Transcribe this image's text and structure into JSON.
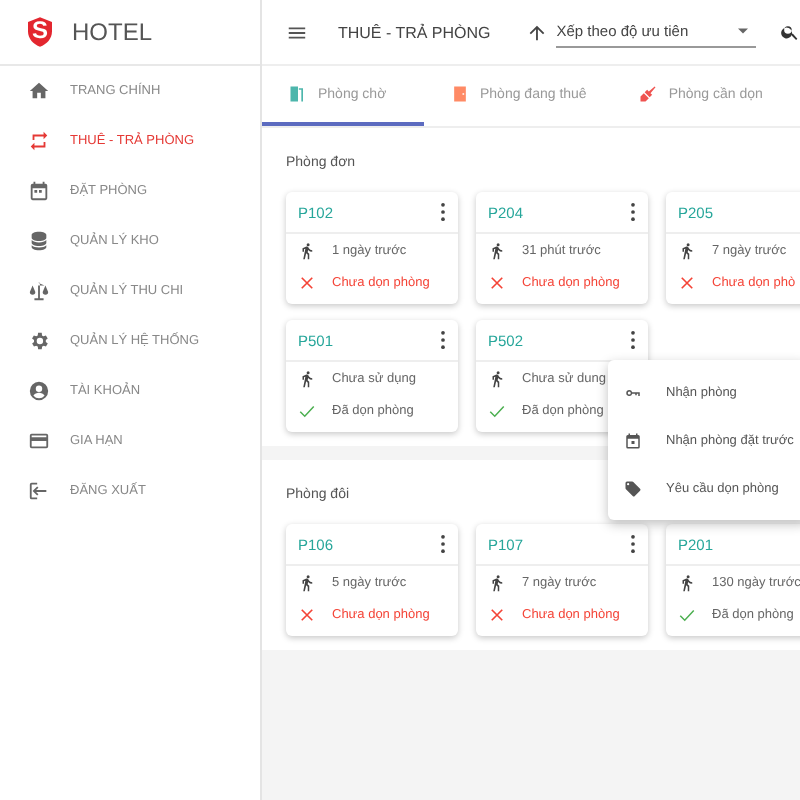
{
  "brand": {
    "name": "HOTEL",
    "logo_letter": "S"
  },
  "sidebar": {
    "items": [
      {
        "label": "TRANG CHÍNH",
        "selected": false
      },
      {
        "label": "THUÊ - TRẢ PHÒNG",
        "selected": true
      },
      {
        "label": "ĐẶT PHÒNG",
        "selected": false
      },
      {
        "label": "QUẢN LÝ KHO",
        "selected": false
      },
      {
        "label": "QUẢN LÝ THU CHI",
        "selected": false
      },
      {
        "label": "QUẢN LÝ HỆ THỐNG",
        "selected": false
      },
      {
        "label": "TÀI KHOẢN",
        "selected": false
      },
      {
        "label": "GIA HẠN",
        "selected": false
      },
      {
        "label": "ĐĂNG XUẤT",
        "selected": false
      }
    ]
  },
  "header": {
    "title": "THUÊ - TRẢ PHÒNG",
    "sort": {
      "value": "Xếp theo độ ưu tiên"
    }
  },
  "tabs": [
    {
      "label": "Phòng chờ",
      "selected": true
    },
    {
      "label": "Phòng đang thuê",
      "selected": false
    },
    {
      "label": "Phòng cần dọn",
      "selected": false
    }
  ],
  "sections": [
    {
      "title": "Phòng đơn",
      "rooms": [
        {
          "name": "P102",
          "time": "1 ngày trước",
          "cleaned": false,
          "status": "Chưa dọn phòng",
          "menu_button": true
        },
        {
          "name": "P204",
          "time": "31 phút trước",
          "cleaned": false,
          "status": "Chưa dọn phòng",
          "menu_button": true
        },
        {
          "name": "P205",
          "time": "7 ngày trước",
          "cleaned": false,
          "status": "Chưa dọn phò",
          "menu_button": false
        },
        {
          "name": "P501",
          "time": "Chưa sử dụng",
          "cleaned": true,
          "status": "Đã dọn phòng",
          "menu_button": true
        },
        {
          "name": "P502",
          "time": "Chưa sử dung",
          "cleaned": true,
          "status": "Đã dọn phòng",
          "menu_button": true
        }
      ]
    },
    {
      "title": "Phòng đôi",
      "rooms": [
        {
          "name": "P106",
          "time": "5 ngày trước",
          "cleaned": false,
          "status": "Chưa dọn phòng",
          "menu_button": true
        },
        {
          "name": "P107",
          "time": "7 ngày trước",
          "cleaned": false,
          "status": "Chưa dọn phòng",
          "menu_button": true
        },
        {
          "name": "P201",
          "time": "130 ngày trước",
          "cleaned": true,
          "status": "Đã dọn phòng",
          "menu_button": false
        }
      ]
    }
  ],
  "context_menu": {
    "items": [
      {
        "label": "Nhận phòng"
      },
      {
        "label": "Nhận phòng đặt trước"
      },
      {
        "label": "Yêu cầu dọn phòng"
      }
    ]
  }
}
